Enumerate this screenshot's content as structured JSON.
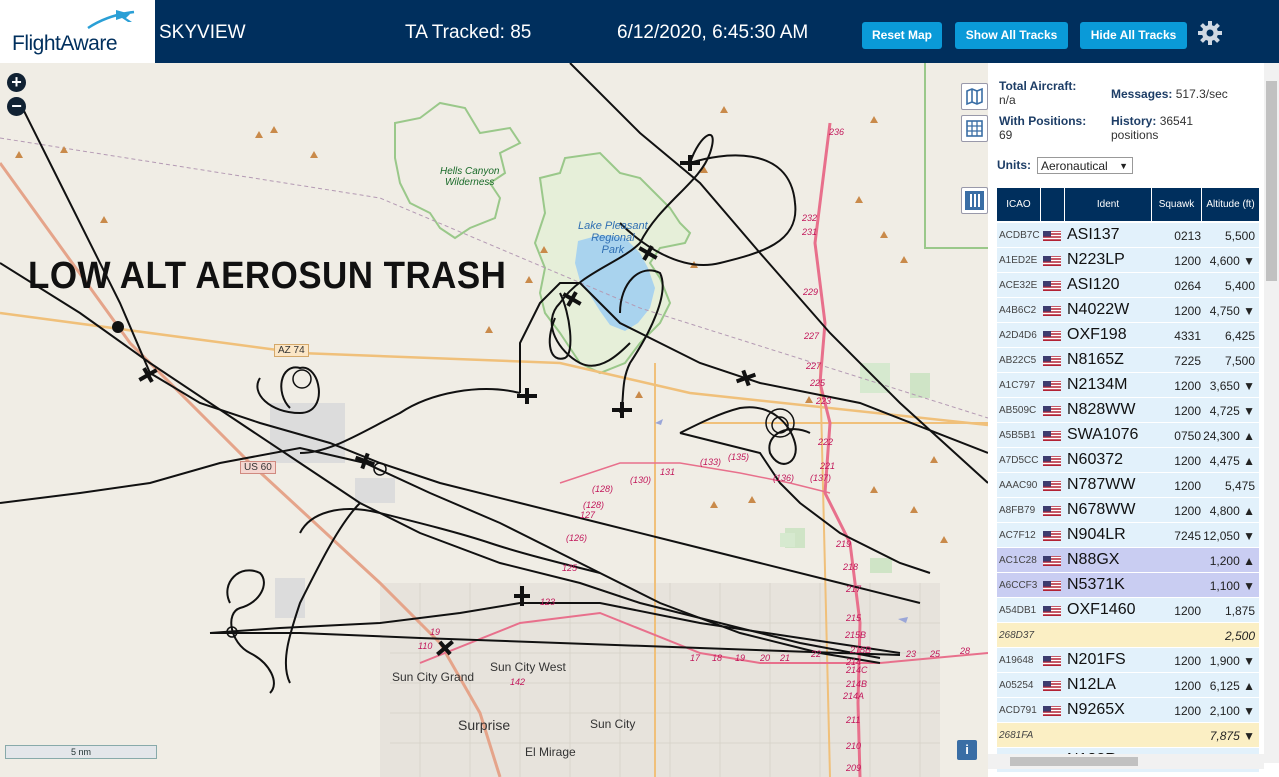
{
  "header": {
    "logo_text": "FlightAware",
    "app_name": "SKYVIEW",
    "tracked": "TA Tracked: 85",
    "datetime": "6/12/2020, 6:45:30 AM",
    "buttons": {
      "reset": "Reset Map",
      "show_all": "Show All Tracks",
      "hide_all": "Hide All Tracks"
    },
    "settings_icon": "gear-icon"
  },
  "map": {
    "overlay_text": "LOW ALT AEROSUN TRASH",
    "scale": "5 nm",
    "zoom_in": "+",
    "zoom_out": "−",
    "info": "i",
    "labels": {
      "hells_canyon": "Hells Canyon\nWilderness",
      "lake_pleasant": "Lake Pleasant\nRegional\nPark",
      "az74": "AZ 74",
      "us60": "US 60",
      "sun_city_west": "Sun City West",
      "sun_city_grand": "Sun City Grand",
      "surprise": "Surprise",
      "sun_city": "Sun City",
      "el_mirage": "El Mirage"
    },
    "route_markers": [
      "236",
      "232",
      "231",
      "229",
      "227",
      "227",
      "225",
      "223",
      "222",
      "221",
      "219",
      "218",
      "217",
      "215",
      "215B",
      "215B",
      "214",
      "214C",
      "214B",
      "214A",
      "211",
      "210",
      "209",
      "(128)",
      "(130)",
      "131",
      "(133)",
      "(135)",
      "(136)",
      "(137)",
      "(128)",
      "127",
      "(126)",
      "125",
      "123",
      "121",
      "19",
      "110",
      "142",
      "17",
      "18",
      "19",
      "20",
      "21",
      "22",
      "23",
      "25",
      "26",
      "28"
    ]
  },
  "panel": {
    "total_aircraft_label": "Total Aircraft:",
    "total_aircraft_value": "n/a",
    "with_positions_label": "With Positions:",
    "with_positions_value": "69",
    "messages_label": "Messages:",
    "messages_value": "517.3/sec",
    "history_label": "History:",
    "history_value": "36541 positions",
    "units_label": "Units:",
    "units_value": "Aeronautical",
    "columns": [
      "ICAO",
      "",
      "Ident",
      "Squawk",
      "Altitude (ft)"
    ],
    "rows": [
      {
        "icao": "ACDB7C",
        "flag": true,
        "ident": "ASI137",
        "squawk": "0213",
        "alt": "5,500",
        "bg": "#e2f1fb"
      },
      {
        "icao": "A1ED2E",
        "flag": true,
        "ident": "N223LP",
        "squawk": "1200",
        "alt": "4,600 ▼",
        "bg": "#e2f1fb"
      },
      {
        "icao": "ACE32E",
        "flag": true,
        "ident": "ASI120",
        "squawk": "0264",
        "alt": "5,400",
        "bg": "#e2f1fb"
      },
      {
        "icao": "A4B6C2",
        "flag": true,
        "ident": "N4022W",
        "squawk": "1200",
        "alt": "4,750 ▼",
        "bg": "#e2f1fb"
      },
      {
        "icao": "A2D4D6",
        "flag": true,
        "ident": "OXF198",
        "squawk": "4331",
        "alt": "6,425",
        "bg": "#e2f1fb"
      },
      {
        "icao": "AB22C5",
        "flag": true,
        "ident": "N8165Z",
        "squawk": "7225",
        "alt": "7,500",
        "bg": "#e2f1fb"
      },
      {
        "icao": "A1C797",
        "flag": true,
        "ident": "N2134M",
        "squawk": "1200",
        "alt": "3,650 ▼",
        "bg": "#e2f1fb"
      },
      {
        "icao": "AB509C",
        "flag": true,
        "ident": "N828WW",
        "squawk": "1200",
        "alt": "4,725 ▼",
        "bg": "#e2f1fb"
      },
      {
        "icao": "A5B5B1",
        "flag": true,
        "ident": "SWA1076",
        "squawk": "0750",
        "alt": "24,300 ▲",
        "bg": "#e2f1fb"
      },
      {
        "icao": "A7D5CC",
        "flag": true,
        "ident": "N60372",
        "squawk": "1200",
        "alt": "4,475 ▲",
        "bg": "#e2f1fb"
      },
      {
        "icao": "AAAC90",
        "flag": true,
        "ident": "N787WW",
        "squawk": "1200",
        "alt": "5,475",
        "bg": "#e2f1fb"
      },
      {
        "icao": "A8FB79",
        "flag": true,
        "ident": "N678WW",
        "squawk": "1200",
        "alt": "4,800 ▲",
        "bg": "#e2f1fb"
      },
      {
        "icao": "AC7F12",
        "flag": true,
        "ident": "N904LR",
        "squawk": "7245",
        "alt": "12,050 ▼",
        "bg": "#e2f1fb"
      },
      {
        "icao": "AC1C28",
        "flag": true,
        "ident": "N88GX",
        "squawk": "",
        "alt": "1,200 ▲",
        "bg": "#c9cdf2"
      },
      {
        "icao": "A6CCF3",
        "flag": true,
        "ident": "N5371K",
        "squawk": "",
        "alt": "1,100 ▼",
        "bg": "#c9cdf2"
      },
      {
        "icao": "A54DB1",
        "flag": true,
        "ident": "OXF1460",
        "squawk": "1200",
        "alt": "1,875",
        "bg": "#e2f1fb"
      },
      {
        "icao": "268D37",
        "flag": false,
        "ident": "",
        "squawk": "",
        "alt": "2,500",
        "bg": "#fbefc4"
      },
      {
        "icao": "A19648",
        "flag": true,
        "ident": "N201FS",
        "squawk": "1200",
        "alt": "1,900 ▼",
        "bg": "#e2f1fb"
      },
      {
        "icao": "A05254",
        "flag": true,
        "ident": "N12LA",
        "squawk": "1200",
        "alt": "6,125 ▲",
        "bg": "#e2f1fb"
      },
      {
        "icao": "ACD791",
        "flag": true,
        "ident": "N9265X",
        "squawk": "1200",
        "alt": "2,100 ▼",
        "bg": "#e2f1fb"
      },
      {
        "icao": "2681FA",
        "flag": false,
        "ident": "",
        "squawk": "",
        "alt": "7,875 ▼",
        "bg": "#fbefc4"
      },
      {
        "icao": "A14991",
        "flag": true,
        "ident": "N182R",
        "squawk": "1200",
        "alt": "5,500 ▲",
        "bg": "#e2f1fb"
      }
    ]
  },
  "colors": {
    "header_bg": "#002f5d",
    "button_bg": "#0a9ad8",
    "map_bg": "#f0ede5",
    "lake": "#a9d3ee",
    "park_border": "#9ac88a",
    "highway": "#e8708c",
    "road_orange": "#f0c07a"
  }
}
